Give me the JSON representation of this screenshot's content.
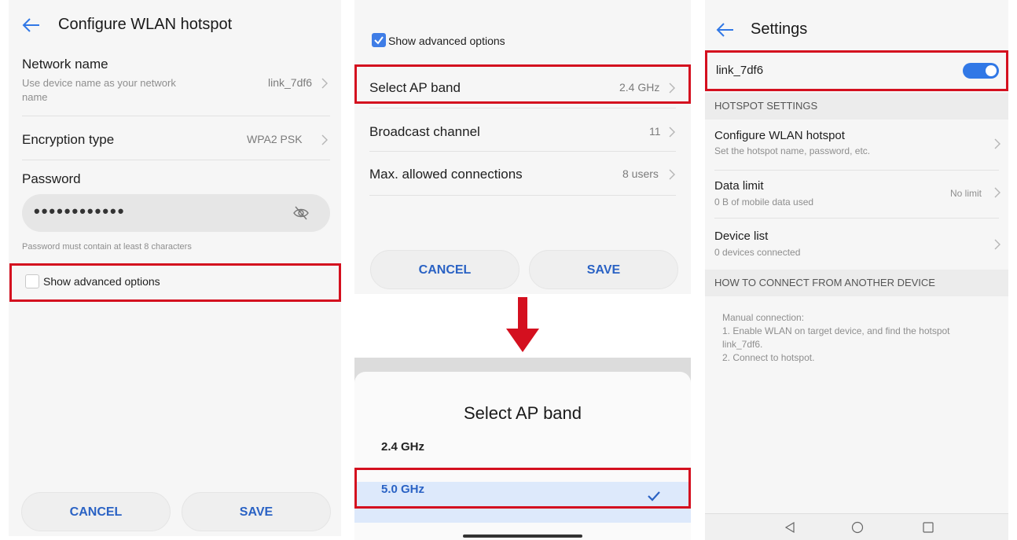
{
  "screen1": {
    "title": "Configure WLAN hotspot",
    "network_name": {
      "label": "Network name",
      "sub_line1": "Use device name as your network",
      "sub_line2": "name",
      "value": "link_7df6"
    },
    "encryption": {
      "label": "Encryption type",
      "value": "WPA2 PSK"
    },
    "password": {
      "label": "Password",
      "masked_value": "••••••••••••",
      "hint": "Password must contain at least 8 characters"
    },
    "advanced_label": "Show advanced options",
    "advanced_checked": false,
    "cancel_label": "CANCEL",
    "save_label": "SAVE"
  },
  "screen2": {
    "advanced_label": "Show advanced options",
    "advanced_checked": true,
    "rows": [
      {
        "label": "Select AP band",
        "value": "2.4 GHz"
      },
      {
        "label": "Broadcast channel",
        "value": "11"
      },
      {
        "label": "Max. allowed connections",
        "value": "8 users"
      }
    ],
    "cancel_label": "CANCEL",
    "save_label": "SAVE"
  },
  "screen3": {
    "title": "Select AP band",
    "options": [
      "2.4 GHz",
      "5.0 GHz"
    ],
    "selected_option": "5.0 GHz"
  },
  "screen4": {
    "title": "Settings",
    "hotspot_name": "link_7df6",
    "hotspot_enabled": true,
    "section_hotspot": "HOTSPOT SETTINGS",
    "configure": {
      "label": "Configure WLAN hotspot",
      "sub": "Set the hotspot name, password, etc."
    },
    "data_limit": {
      "label": "Data limit",
      "sub": "0 B of mobile data used",
      "value": "No limit"
    },
    "device_list": {
      "label": "Device list",
      "sub": "0 devices connected"
    },
    "section_connect": "HOW TO CONNECT FROM ANOTHER DEVICE",
    "instructions": {
      "line1": "Manual connection:",
      "line2": "1. Enable WLAN on target device, and find the hotspot",
      "line3": "link_7df6.",
      "line4": "2. Connect to hotspot."
    }
  },
  "colors": {
    "accent_blue": "#2a62c4",
    "highlight_red": "#d4101f",
    "toggle_blue": "#3178e6",
    "arrow_red": "#d4101f"
  },
  "icons": [
    "back-arrow-icon",
    "chevron-right-icon",
    "eye-off-icon",
    "check-icon",
    "checkmark-icon",
    "down-arrow-icon",
    "nav-back-icon",
    "nav-home-icon",
    "nav-recents-icon"
  ]
}
